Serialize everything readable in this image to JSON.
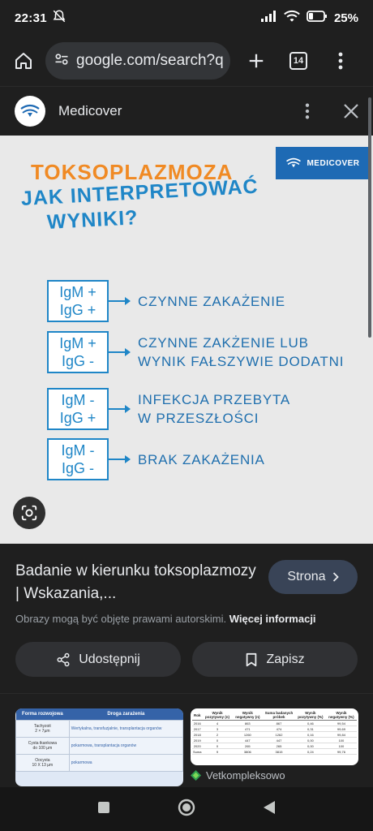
{
  "status": {
    "time": "22:31",
    "battery": "25%"
  },
  "toolbar": {
    "url": "google.com/search?q",
    "tabs_count": "14"
  },
  "panel": {
    "site_name": "Medicover"
  },
  "hero": {
    "brand": "MEDICOVER",
    "title_line1": "TOKSOPLAZMOZA",
    "title_line2": "JAK INTERPRETOWAĆ",
    "title_line3": "WYNIKI?",
    "rows": [
      {
        "igm": "IgM +",
        "igg": "IgG +",
        "result_l1": "CZYNNE ZAKAŻENIE",
        "result_l2": ""
      },
      {
        "igm": "IgM +",
        "igg": "IgG -",
        "result_l1": "CZYNNE ZAKŻENIE LUB",
        "result_l2": "WYNIK FAŁSZYWIE DODATNI"
      },
      {
        "igm": "IgM -",
        "igg": "IgG +",
        "result_l1": "INFEKCJA PRZEBYTA",
        "result_l2": "W PRZESZŁOŚCI"
      },
      {
        "igm": "IgM -",
        "igg": "IgG -",
        "result_l1": "BRAK ZAKAŻENIA",
        "result_l2": ""
      }
    ]
  },
  "info": {
    "title": "Badanie w kierunku toksoplazmozy | Wskazania,...",
    "visit_label": "Strona",
    "copyright_text": "Obrazy mogą być objęte prawami autorskimi.",
    "more_info": "Więcej informacji",
    "share_label": "Udostępnij",
    "save_label": "Zapisz"
  },
  "related": {
    "thumb1": {
      "headers": [
        "Forma rozwojowa",
        "Droga zarażenia"
      ],
      "rows": [
        [
          "Tachyzoit\n2 × 7µm",
          "Wertykalna, transfuzjalnie, transplantacja organów"
        ],
        [
          "Cysta tkankowa\ndo 100 µm",
          "pokarmowa, transplantacja organów"
        ],
        [
          "Oocysta\n10 X 13 µm",
          "pokarmowa"
        ]
      ]
    },
    "thumb2": {
      "headers": [
        "Rok",
        "Wynik pozytywny (n)",
        "Wynik negatywny (n)",
        "Suma badanych próbek",
        "Wynik pozytywny (%)",
        "Wynik negatywny (%)"
      ],
      "rows": [
        [
          "2016",
          "4",
          "863",
          "867",
          "0,46",
          "99,54"
        ],
        [
          "2017",
          "3",
          "471",
          "474",
          "0,31",
          "99,69"
        ],
        [
          "2018",
          "2",
          "1260",
          "1262",
          "0,16",
          "99,84"
        ],
        [
          "2019",
          "0",
          "447",
          "447",
          "0,00",
          "100"
        ],
        [
          "2020",
          "0",
          "265",
          "265",
          "0,00",
          "100"
        ],
        [
          "Suma",
          "9",
          "3806",
          "3815",
          "0,24",
          "99,76"
        ]
      ],
      "source": "Vetkompleksowo"
    }
  }
}
